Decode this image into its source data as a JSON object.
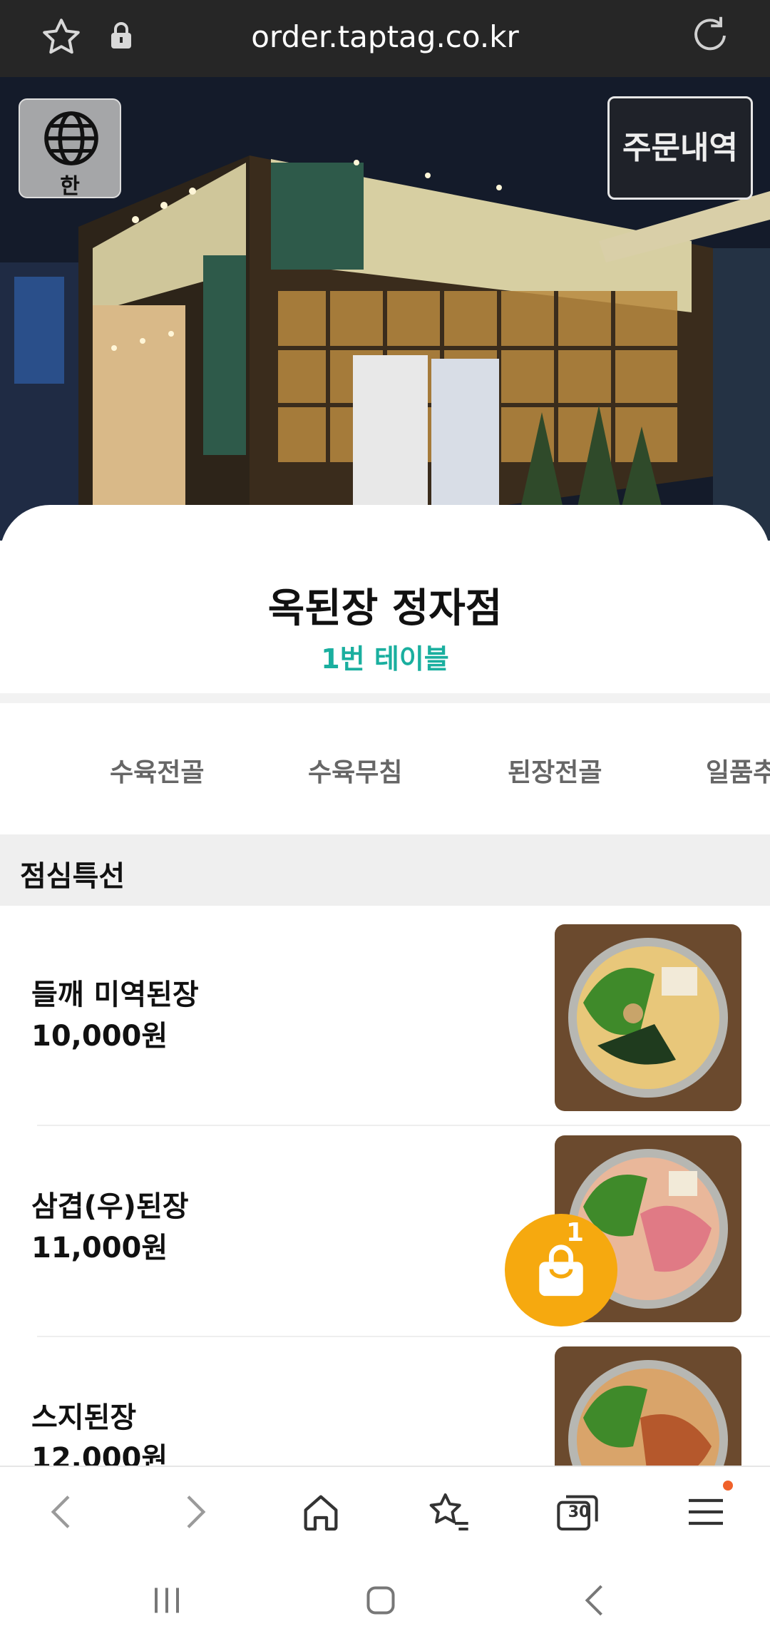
{
  "browser": {
    "url": "order.taptag.co.kr",
    "tabs_count": "30"
  },
  "header": {
    "language_label": "한",
    "order_history_label": "주문내역"
  },
  "store": {
    "name": "옥된장 정자점",
    "table": "1번 테이블"
  },
  "categories": [
    "수육전골",
    "수육무침",
    "된장전골",
    "일품추"
  ],
  "section": {
    "title": "점심특선"
  },
  "menu": [
    {
      "name": "들깨 미역된장",
      "price": "10,000원"
    },
    {
      "name": "삼겹(우)된장",
      "price": "11,000원"
    },
    {
      "name": "스지된장",
      "price": "12,000원"
    }
  ],
  "cart": {
    "count": "1"
  },
  "colors": {
    "accent_teal": "#1aaf9f",
    "cart_orange": "#f6a90f",
    "notification_dot": "#f0612a"
  }
}
